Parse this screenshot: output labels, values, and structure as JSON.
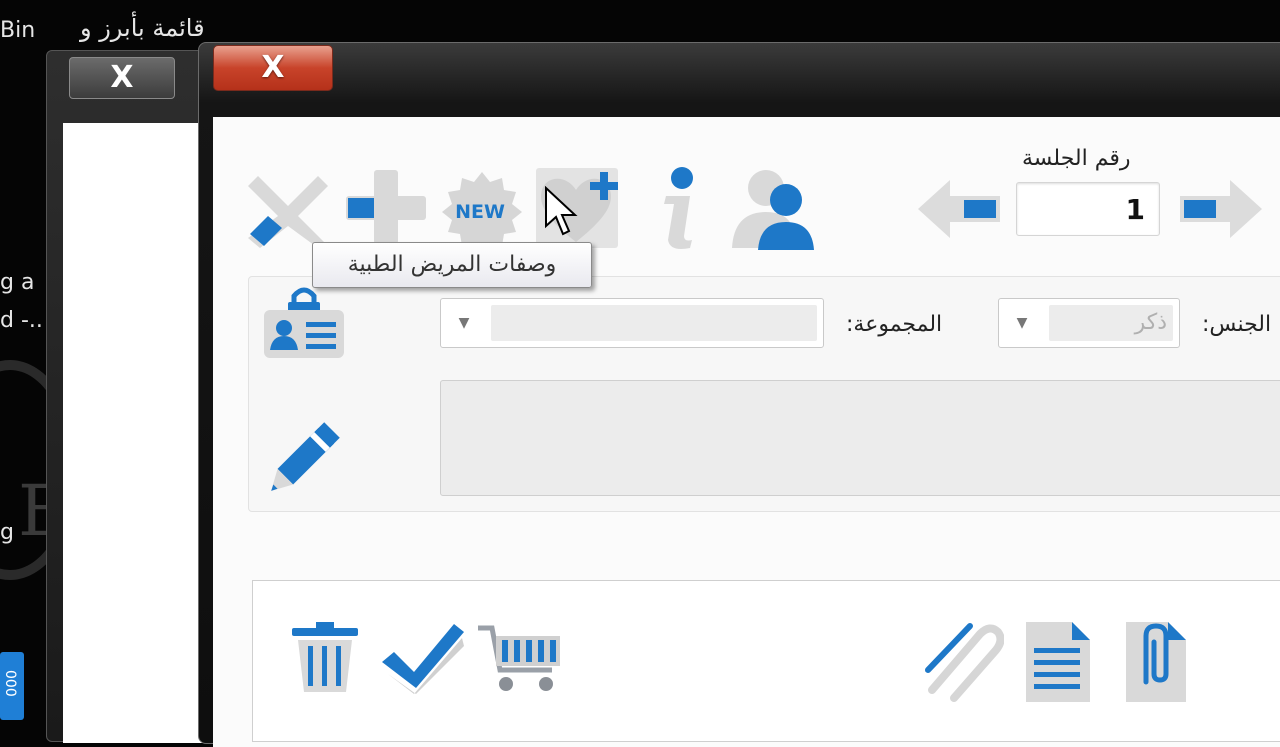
{
  "desktop": {
    "top_left_text": "Bin",
    "top_right_text": "قائمة بأبرز و",
    "side_text_1": "g a",
    "side_text_2": "d -..",
    "side_text_3": "g",
    "taskbar_tile_text": "000"
  },
  "back_window": {
    "close_label": "X"
  },
  "front_window": {
    "close_label": "X",
    "toolbar": {
      "icons": [
        "delete-x-icon",
        "add-plus-icon",
        "new-badge-icon",
        "heart-plus-icon",
        "info-icon",
        "user-icon",
        "arrow-left-icon",
        "arrow-right-icon"
      ],
      "new_badge_text": "NEW"
    },
    "session": {
      "label": "رقم الجلسة",
      "value": "1"
    },
    "tooltip": "وصفات المريض الطبية",
    "form": {
      "gender_label": "الجنس:",
      "gender_value": "ذكر",
      "group_label": "المجموعة:",
      "group_value": ""
    },
    "bottom_icons": [
      "trash-icon",
      "checkmark-icon",
      "cart-icon",
      "paperclip-icon",
      "document-icon",
      "attach-doc-icon"
    ]
  },
  "colors": {
    "accent_blue": "#1e78c8",
    "close_red": "#c8432a"
  }
}
